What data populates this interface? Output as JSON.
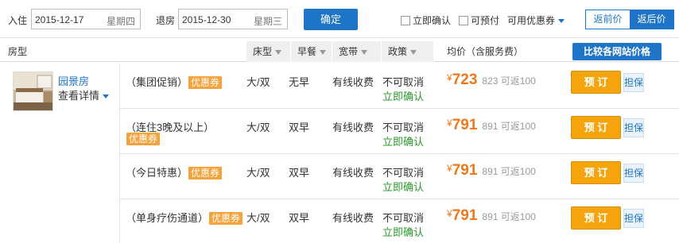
{
  "search": {
    "checkin_label": "入住",
    "checkin_date": "2015-12-17",
    "checkin_weekday": "星期四",
    "checkout_label": "退房",
    "checkout_date": "2015-12-30",
    "checkout_weekday": "星期三",
    "confirm_button": "确定",
    "filter_instant": "立即确认",
    "filter_prepay": "可预付",
    "filter_coupon": "可用优惠券",
    "price_before_label": "返前价",
    "price_after_label": "返后价"
  },
  "header": {
    "room_type": "房型",
    "bed": "床型",
    "breakfast": "早餐",
    "broadband": "宽带",
    "policy": "政策",
    "avg_price": "均价（含服务费）",
    "compare_button": "比较各网站价格"
  },
  "room": {
    "name": "园景房",
    "detail_link": "查看详情"
  },
  "rows": [
    {
      "name": "（集团促销）",
      "coupon": "优惠券",
      "bed": "大/双",
      "breakfast": "无早",
      "broadband": "有线收费",
      "policy": "不可取消",
      "confirm": "立即确认",
      "currency": "¥",
      "price": "723",
      "original": "823",
      "cashback": "可返100",
      "book": "预 订",
      "guarantee": "担保"
    },
    {
      "name": "（连住3晚及以上）",
      "coupon": "优惠券",
      "bed": "大/双",
      "breakfast": "双早",
      "broadband": "有线收费",
      "policy": "不可取消",
      "confirm": "立即确认",
      "currency": "¥",
      "price": "791",
      "original": "891",
      "cashback": "可返100",
      "book": "预 订",
      "guarantee": "担保"
    },
    {
      "name": "（今日特惠）",
      "coupon": "优惠券",
      "bed": "大/双",
      "breakfast": "双早",
      "broadband": "有线收费",
      "policy": "不可取消",
      "confirm": "立即确认",
      "currency": "¥",
      "price": "791",
      "original": "891",
      "cashback": "可返100",
      "book": "预 订",
      "guarantee": "担保"
    },
    {
      "name": "（单身疗伤通道）",
      "coupon": "优惠券",
      "bed": "大/双",
      "breakfast": "双早",
      "broadband": "有线收费",
      "policy": "不可取消",
      "confirm": "立即确认",
      "currency": "¥",
      "price": "791",
      "original": "891",
      "cashback": "可返100",
      "book": "预 订",
      "guarantee": "担保"
    }
  ]
}
